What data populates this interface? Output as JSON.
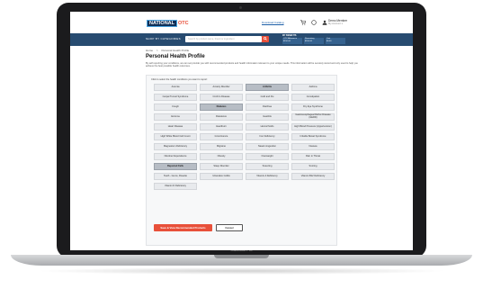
{
  "device": {
    "brand": "MacBook Pro"
  },
  "header": {
    "logo_part1": "NATIONAL",
    "logo_part2": "OTC",
    "link": "Download Catalog",
    "cart_icon": "cart-icon",
    "user_name": "Demo Member",
    "user_sub": "My Account ▾"
  },
  "nav": {
    "shop_by": "SHOP BY CATEGORIES",
    "search_placeholder": "Search by product name, brand or ingredient",
    "fsa_title": "MY BENEFITS",
    "fsa_cols": [
      {
        "label": "OTC Allowance",
        "value": "$150.00"
      },
      {
        "label": "Remaining",
        "value": "$150.00"
      },
      {
        "label": "Cart",
        "value": "$0.00"
      }
    ]
  },
  "breadcrumb": [
    "Home",
    ">",
    "Personal Health Profile"
  ],
  "page": {
    "title": "Personal Health Profile",
    "intro": "By self reporting your conditions, we can set provide you with recommended products and health information relevant to your unique needs. This information will be securely stored and only used to help you achieve the best possible health outcomes."
  },
  "panel": {
    "prompt": "Click to select the health conditions you want to report:",
    "conditions": [
      {
        "label": "Anemia",
        "selected": false
      },
      {
        "label": "Anxiety Disorder",
        "selected": false
      },
      {
        "label": "Arthritis",
        "selected": true
      },
      {
        "label": "Asthma",
        "selected": false
      },
      {
        "label": "Carpal Tunnel Syndrome",
        "selected": false
      },
      {
        "label": "Crohn's Disease",
        "selected": false
      },
      {
        "label": "Cold and Flu",
        "selected": false
      },
      {
        "label": "Constipation",
        "selected": false
      },
      {
        "label": "Cough",
        "selected": false
      },
      {
        "label": "Diabetes",
        "selected": true
      },
      {
        "label": "Diarrhea",
        "selected": false
      },
      {
        "label": "Dry Eye Syndrome",
        "selected": false
      },
      {
        "label": "Eczema",
        "selected": false
      },
      {
        "label": "Flatulence",
        "selected": false
      },
      {
        "label": "Gastritis",
        "selected": false
      },
      {
        "label": "Gastroesophageal Reflux Disease (GERD)",
        "selected": false
      },
      {
        "label": "Heart Disease",
        "selected": false
      },
      {
        "label": "Heartburn",
        "selected": false
      },
      {
        "label": "Hemorrhoids",
        "selected": false
      },
      {
        "label": "High Blood Pressure (Hypertension)",
        "selected": false
      },
      {
        "label": "High White Blood Cell Count",
        "selected": false
      },
      {
        "label": "Incontinence",
        "selected": false
      },
      {
        "label": "Iron Deficiency",
        "selected": false
      },
      {
        "label": "Irritable Bowel Syndrome",
        "selected": false
      },
      {
        "label": "Magnesium Deficiency",
        "selected": false
      },
      {
        "label": "Migraine",
        "selected": false
      },
      {
        "label": "Nasal congestion",
        "selected": false
      },
      {
        "label": "Nausea",
        "selected": false
      },
      {
        "label": "Nicotine Dependence",
        "selected": false
      },
      {
        "label": "Obesity",
        "selected": false
      },
      {
        "label": "Overweight",
        "selected": false
      },
      {
        "label": "Pain in Throat",
        "selected": false
      },
      {
        "label": "Reported Falls",
        "selected": true
      },
      {
        "label": "Sleep Disorder",
        "selected": false
      },
      {
        "label": "Sneezing",
        "selected": false
      },
      {
        "label": "Snoring",
        "selected": false
      },
      {
        "label": "Teeth - Gums, Rosette",
        "selected": false
      },
      {
        "label": "Ulcerative Colitis",
        "selected": false
      },
      {
        "label": "Vitamin A Deficiency",
        "selected": false
      },
      {
        "label": "Vitamin B12 Deficiency",
        "selected": false
      },
      {
        "label": "Vitamin D Deficiency",
        "selected": false
      }
    ]
  },
  "actions": {
    "save": "Save & View Recommended Products",
    "cancel": "Cancel"
  },
  "colors": {
    "accent": "#e8503a",
    "nav": "#274b70",
    "selected": "#b7bdc5"
  }
}
